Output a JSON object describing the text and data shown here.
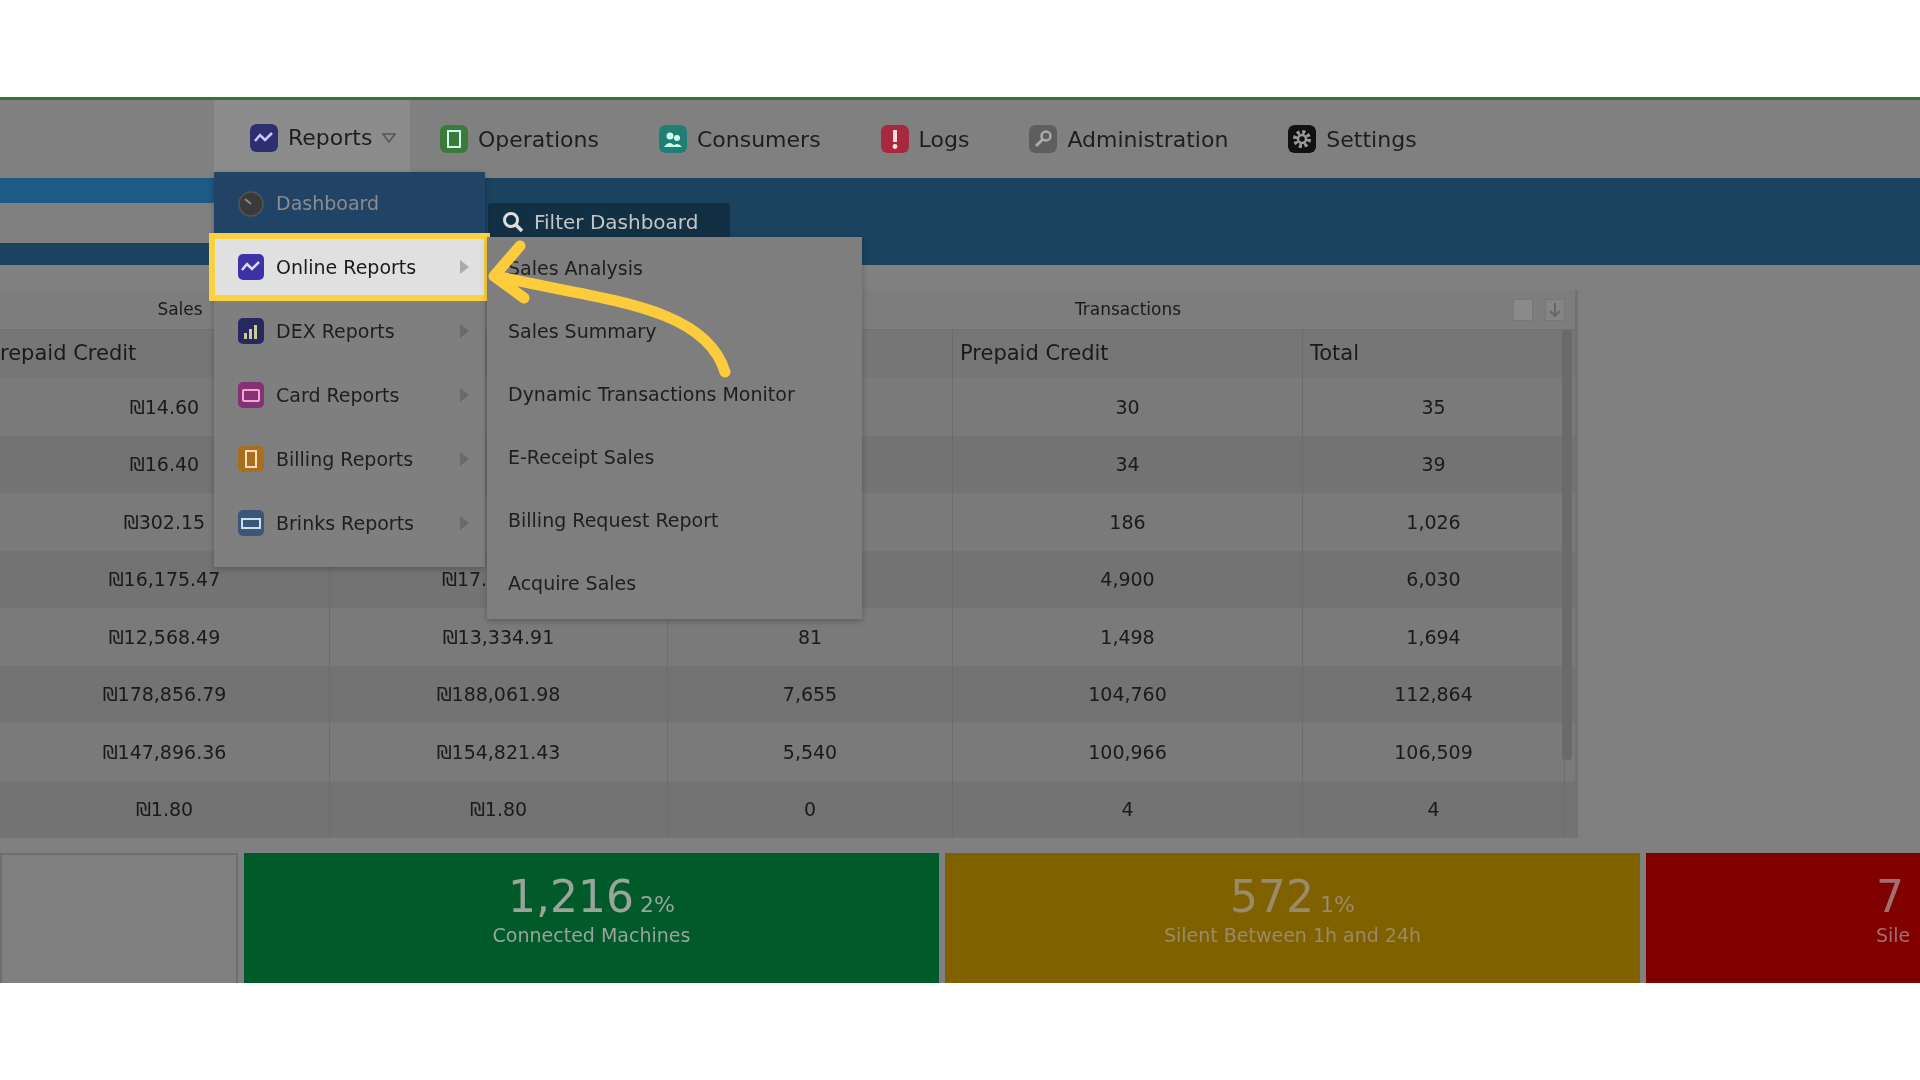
{
  "nav": [
    {
      "label": "Reports",
      "selected": true,
      "caret": true
    },
    {
      "label": "Operations",
      "selected": false
    },
    {
      "label": "Consumers",
      "selected": false
    },
    {
      "label": "Logs",
      "selected": false
    },
    {
      "label": "Administration",
      "selected": false
    },
    {
      "label": "Settings",
      "selected": false
    }
  ],
  "filter_button": "Filter Dashboard",
  "menu": [
    {
      "label": "Dashboard",
      "kind": "current",
      "selected": false,
      "submenu": false
    },
    {
      "label": "Online Reports",
      "kind": "item",
      "selected": true,
      "submenu": true
    },
    {
      "label": "DEX Reports",
      "kind": "item",
      "selected": false,
      "submenu": true
    },
    {
      "label": "Card Reports",
      "kind": "item",
      "selected": false,
      "submenu": true
    },
    {
      "label": "Billing Reports",
      "kind": "item",
      "selected": false,
      "submenu": true
    },
    {
      "label": "Brinks Reports",
      "kind": "item",
      "selected": false,
      "submenu": true
    }
  ],
  "submenu": [
    "Sales Analysis",
    "Sales Summary",
    "Dynamic Transactions Monitor",
    "E-Receipt Sales",
    "Billing Request Report",
    "Acquire Sales"
  ],
  "table": {
    "groups": [
      "Sales",
      "Transactions"
    ],
    "select_all": {
      "checked": false
    },
    "columns": [
      "repaid Credit",
      null,
      null,
      "Prepaid Credit",
      "Total"
    ],
    "rows": [
      [
        "₪14.60",
        null,
        null,
        "30",
        "35"
      ],
      [
        "₪16.40",
        null,
        null,
        "34",
        "39"
      ],
      [
        "₪302.15",
        null,
        null,
        "186",
        "1,026"
      ],
      [
        "₪16,175.47",
        {
          "text": "₪17.",
          "kind": "cut"
        },
        null,
        "4,900",
        "6,030"
      ],
      [
        "₪12,568.49",
        "₪13,334.91",
        "81",
        "1,498",
        "1,694"
      ],
      [
        "₪178,856.79",
        "₪188,061.98",
        "7,655",
        "104,760",
        "112,864"
      ],
      [
        "₪147,896.36",
        "₪154,821.43",
        "5,540",
        "100,966",
        "106,509"
      ],
      [
        "₪1.80",
        "₪1.80",
        "0",
        "4",
        "4"
      ]
    ]
  },
  "tiles": [
    {
      "kind": "blank"
    },
    {
      "kind": "stat",
      "value": "1,216",
      "percent": "2%",
      "label": "Connected Machines",
      "color": "#005a2a"
    },
    {
      "kind": "stat",
      "value": "572",
      "percent": "1%",
      "label": "Silent Between 1h and 24h",
      "color": "#806100"
    },
    {
      "kind": "stat",
      "value": "7",
      "label": "Sile",
      "color": "#800000"
    }
  ]
}
